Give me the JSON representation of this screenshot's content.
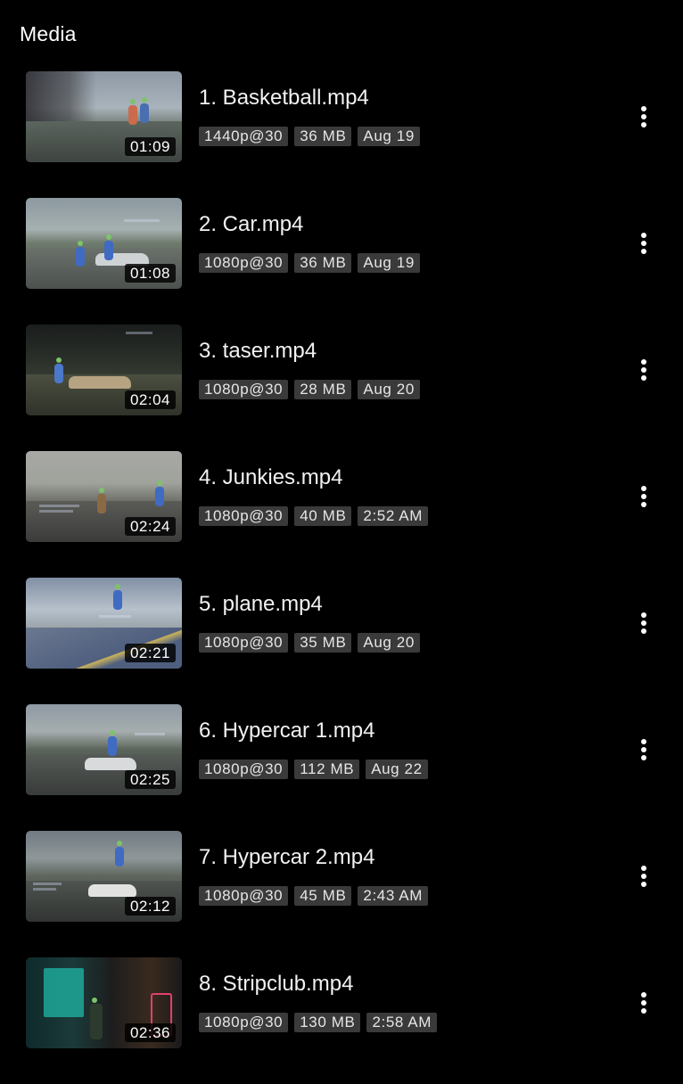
{
  "header": {
    "title": "Media"
  },
  "icons": {
    "more": "more-vertical-icon"
  },
  "videos": [
    {
      "title": "1. Basketball.mp4",
      "duration": "01:09",
      "resolution": "1440p@30",
      "size": "36 MB",
      "date": "Aug 19"
    },
    {
      "title": "2. Car.mp4",
      "duration": "01:08",
      "resolution": "1080p@30",
      "size": "36 MB",
      "date": "Aug 19"
    },
    {
      "title": "3. taser.mp4",
      "duration": "02:04",
      "resolution": "1080p@30",
      "size": "28 MB",
      "date": "Aug 20"
    },
    {
      "title": "4. Junkies.mp4",
      "duration": "02:24",
      "resolution": "1080p@30",
      "size": "40 MB",
      "date": "2:52 AM"
    },
    {
      "title": "5. plane.mp4",
      "duration": "02:21",
      "resolution": "1080p@30",
      "size": "35 MB",
      "date": "Aug 20"
    },
    {
      "title": "6. Hypercar 1.mp4",
      "duration": "02:25",
      "resolution": "1080p@30",
      "size": "112 MB",
      "date": "Aug 22"
    },
    {
      "title": "7. Hypercar 2.mp4",
      "duration": "02:12",
      "resolution": "1080p@30",
      "size": "45 MB",
      "date": "2:43 AM"
    },
    {
      "title": "8. Stripclub.mp4",
      "duration": "02:36",
      "resolution": "1080p@30",
      "size": "130 MB",
      "date": "2:58 AM"
    }
  ]
}
